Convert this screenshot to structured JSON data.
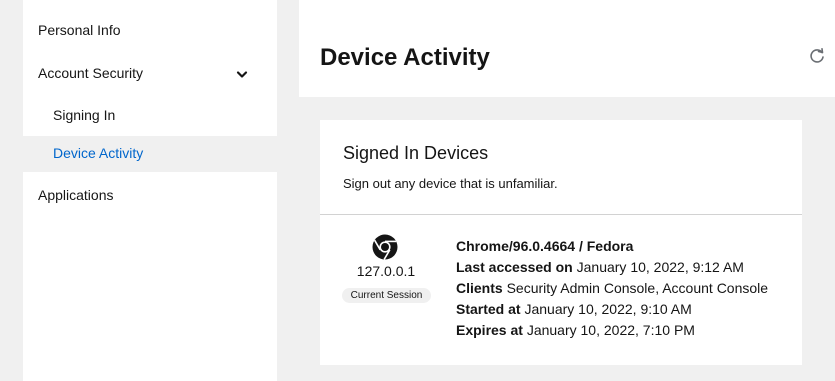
{
  "sidebar": {
    "personal_info": "Personal Info",
    "account_security": "Account Security",
    "signing_in": "Signing In",
    "device_activity": "Device Activity",
    "applications": "Applications"
  },
  "header": {
    "title": "Device Activity"
  },
  "card": {
    "title": "Signed In Devices",
    "subtitle": "Sign out any device that is unfamiliar.",
    "device": {
      "ip": "127.0.0.1",
      "badge": "Current Session",
      "name": "Chrome/96.0.4664 / Fedora",
      "last_accessed_label": "Last accessed on",
      "last_accessed": "January 10, 2022, 9:12 AM",
      "clients_label": "Clients",
      "clients": "Security Admin Console, Account Console",
      "started_label": "Started at",
      "started": "January 10, 2022, 9:10 AM",
      "expires_label": "Expires at",
      "expires": "January 10, 2022, 7:10 PM"
    }
  },
  "icons": {
    "refresh": "refresh-icon",
    "chevron": "chevron-down-icon",
    "browser": "chrome-icon"
  },
  "colors": {
    "active_link": "#0066cc",
    "background": "#f0f0f0"
  }
}
